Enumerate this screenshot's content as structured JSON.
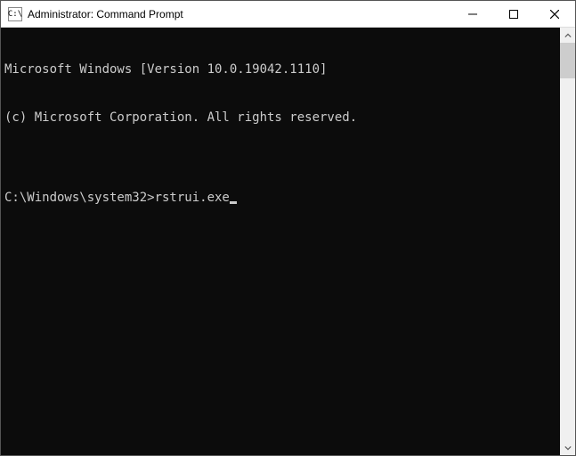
{
  "window": {
    "title": "Administrator: Command Prompt",
    "icon_text": "C:\\"
  },
  "console": {
    "line1": "Microsoft Windows [Version 10.0.19042.1110]",
    "line2": "(c) Microsoft Corporation. All rights reserved.",
    "blank": "",
    "prompt": "C:\\Windows\\system32>",
    "command": "rstrui.exe"
  }
}
